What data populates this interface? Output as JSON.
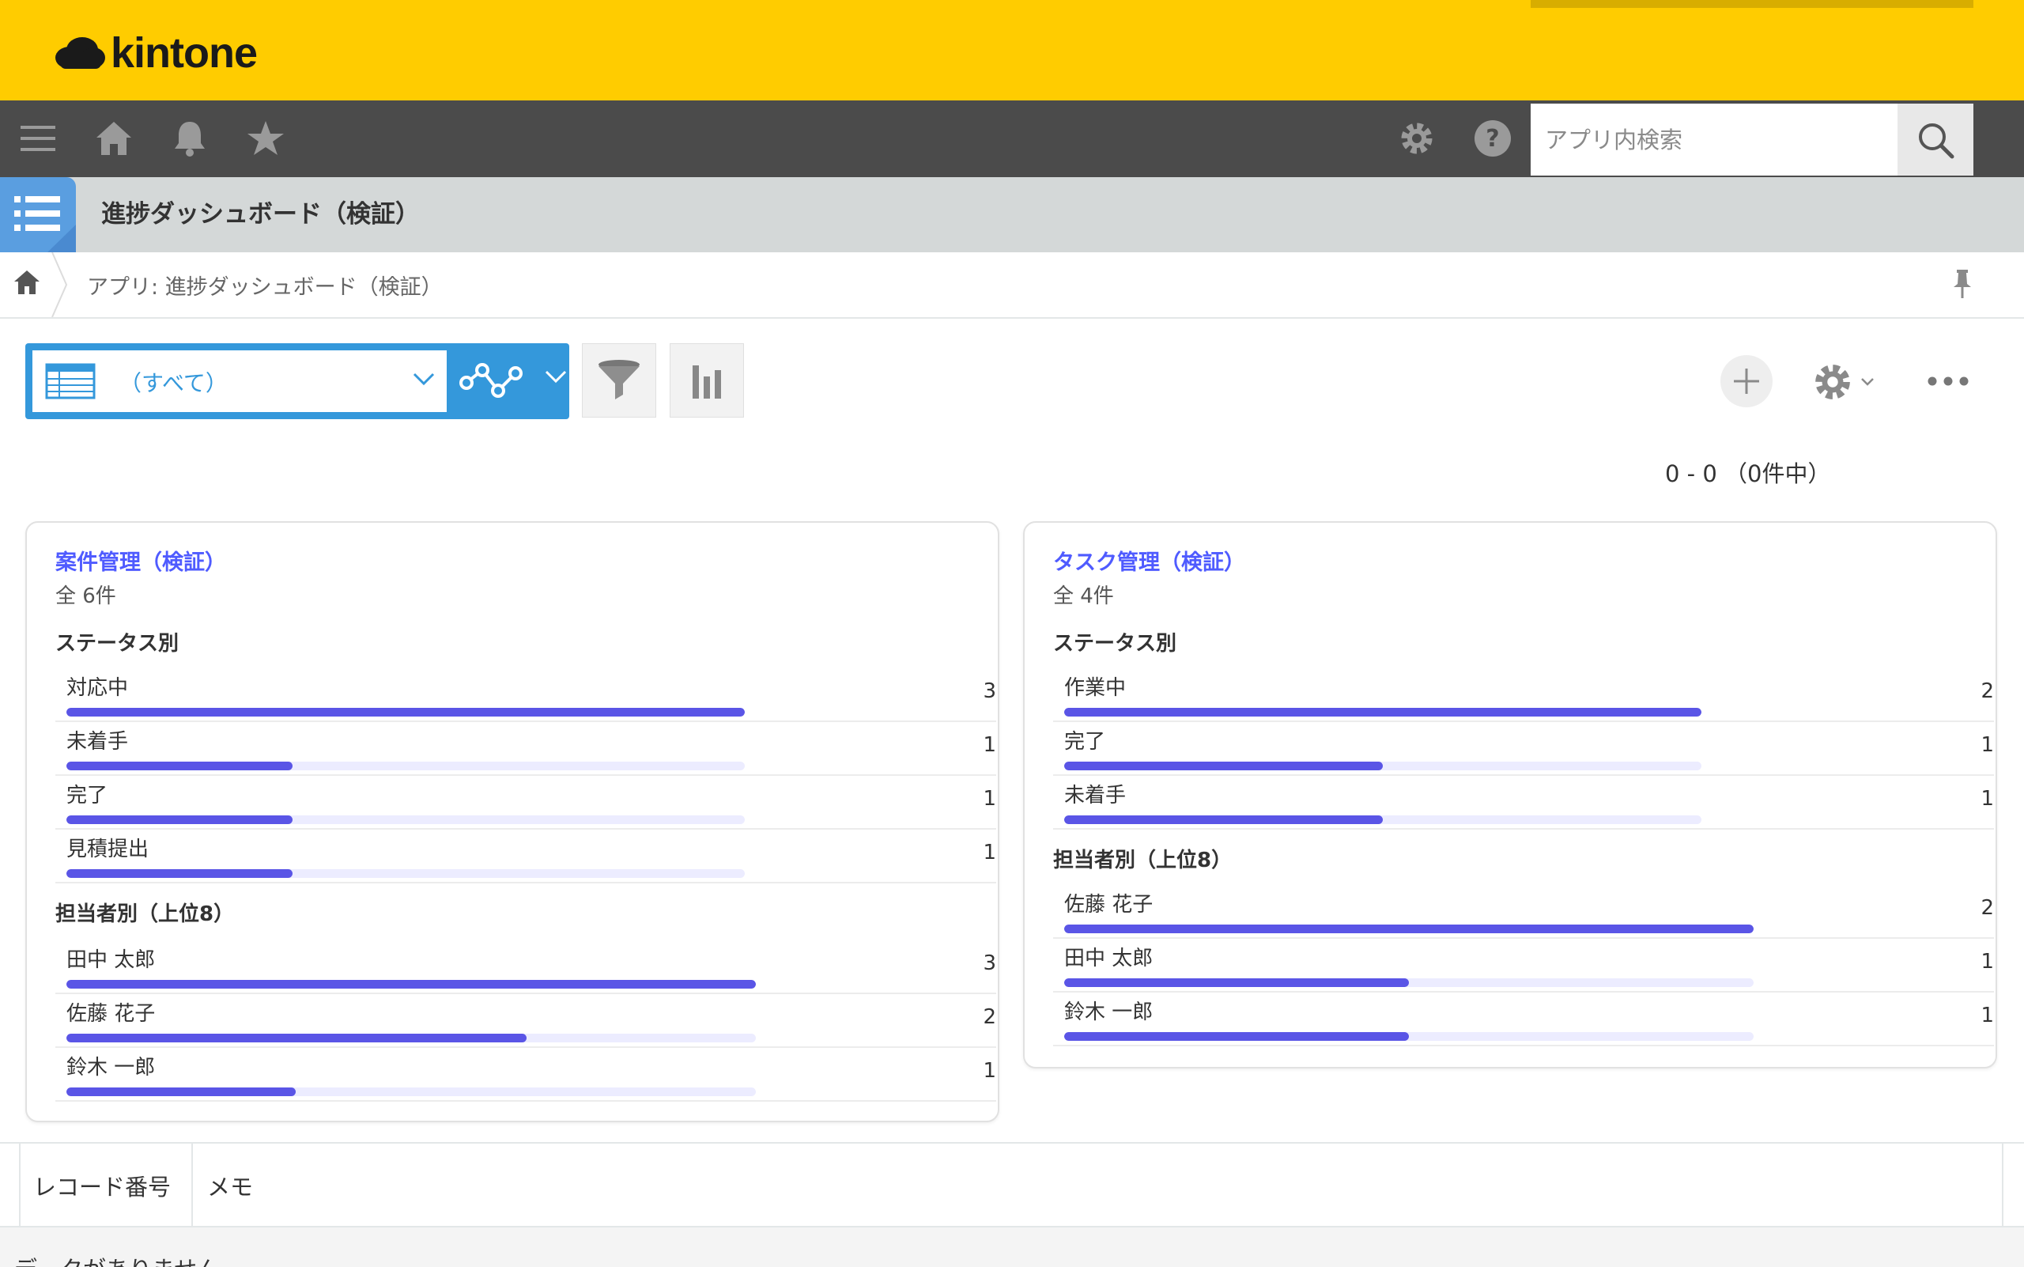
{
  "brand": {
    "logo_text": "kintone"
  },
  "colors": {
    "header_yellow": "#ffcc00",
    "nav_dark": "#4b4b4b",
    "view_blue": "#3498db",
    "bar_fill": "#5a55e6",
    "bar_track": "#ececff",
    "link_purple": "#4f5bff"
  },
  "global_nav": {
    "icons": [
      "menu-icon",
      "home-icon",
      "bell-icon",
      "star-icon",
      "gear-icon",
      "help-icon",
      "search-icon"
    ],
    "search_placeholder": "アプリ内検索"
  },
  "app": {
    "title": "進捗ダッシュボード（検証）",
    "breadcrumb": "アプリ: 進捗ダッシュボード（検証）"
  },
  "toolbar": {
    "view_name": "（すべて）",
    "pager": "0 - 0 （0件中）"
  },
  "cards": [
    {
      "title": "案件管理（検証）",
      "total": "全 6件",
      "sections": [
        {
          "heading": "ステータス別",
          "items": [
            {
              "name": "対応中",
              "count": 3,
              "ratio": 1.0
            },
            {
              "name": "未着手",
              "count": 1,
              "ratio": 0.333
            },
            {
              "name": "完了",
              "count": 1,
              "ratio": 0.333
            },
            {
              "name": "見積提出",
              "count": 1,
              "ratio": 0.333
            }
          ]
        },
        {
          "heading": "担当者別（上位8）",
          "items": [
            {
              "name": "田中 太郎",
              "count": 3,
              "ratio": 1.0
            },
            {
              "name": "佐藤 花子",
              "count": 2,
              "ratio": 0.667
            },
            {
              "name": "鈴木 一郎",
              "count": 1,
              "ratio": 0.333
            }
          ]
        }
      ]
    },
    {
      "title": "タスク管理（検証）",
      "total": "全 4件",
      "sections": [
        {
          "heading": "ステータス別",
          "items": [
            {
              "name": "作業中",
              "count": 2,
              "ratio": 1.0
            },
            {
              "name": "完了",
              "count": 1,
              "ratio": 0.5
            },
            {
              "name": "未着手",
              "count": 1,
              "ratio": 0.5
            }
          ]
        },
        {
          "heading": "担当者別（上位8）",
          "items": [
            {
              "name": "佐藤 花子",
              "count": 2,
              "ratio": 1.0
            },
            {
              "name": "田中 太郎",
              "count": 1,
              "ratio": 0.5
            },
            {
              "name": "鈴木 一郎",
              "count": 1,
              "ratio": 0.5
            }
          ]
        }
      ]
    }
  ],
  "table": {
    "columns": [
      "レコード番号",
      "メモ"
    ],
    "empty_text": "データがありません"
  }
}
